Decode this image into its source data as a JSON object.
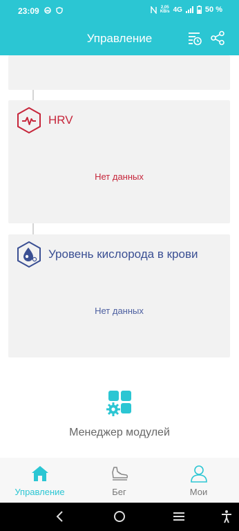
{
  "status_bar": {
    "time": "23:09",
    "network_speed_value": "2,05",
    "network_speed_unit": "KB/s",
    "network_type": "4G",
    "battery": "50 %",
    "icons": [
      "ring-icon",
      "shield-icon",
      "nfc-icon",
      "signal-icon",
      "battery-icon"
    ]
  },
  "header": {
    "title": "Управление",
    "icons": [
      "history-list-icon",
      "share-icon"
    ]
  },
  "cards": [
    {
      "title": "HRV",
      "empty_text": "Нет данных",
      "icon": "hrv-heartbeat-icon",
      "color": "#c6263b"
    },
    {
      "title": "Уровень кислорода в крови",
      "empty_text": "Нет данных",
      "icon": "blood-oxygen-icon",
      "color": "#3a4f93"
    }
  ],
  "module_manager": {
    "label": "Менеджер модулей",
    "icon": "module-grid-icon"
  },
  "bottom_nav": {
    "items": [
      {
        "label": "Управление",
        "icon": "home-icon",
        "active": true
      },
      {
        "label": "Бег",
        "icon": "running-shoe-icon",
        "active": false
      },
      {
        "label": "Мои",
        "icon": "person-icon",
        "active": false
      }
    ]
  },
  "system_nav": [
    "back-icon",
    "home-circle-icon",
    "recents-icon",
    "accessibility-icon"
  ],
  "colors": {
    "accent": "#2bc6d3",
    "hrv": "#c6263b",
    "oxygen": "#3a4f93",
    "card_bg": "#f2f2f2"
  }
}
